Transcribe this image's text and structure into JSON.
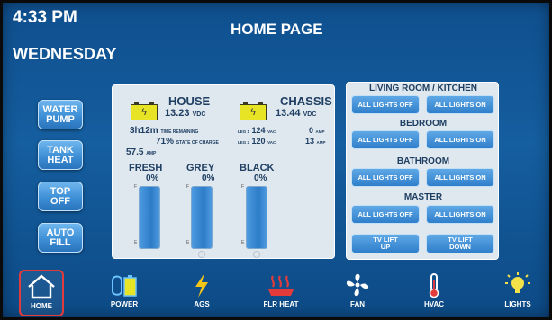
{
  "status": {
    "time": "4:33 PM",
    "day": "WEDNESDAY",
    "page_title": "HOME PAGE"
  },
  "side_buttons": [
    {
      "label": "WATER\nPUMP"
    },
    {
      "label": "TANK\nHEAT"
    },
    {
      "label": "TOP\nOFF"
    },
    {
      "label": "AUTO\nFILL"
    }
  ],
  "power": {
    "house": {
      "title": "HOUSE",
      "bolt": "ϟ",
      "voltage": "13.23",
      "voltage_unit": "VDC",
      "time_value": "3h12m",
      "time_label": "TIME REMAINING",
      "charge_value": "71%",
      "charge_label": "STATE OF CHARGE",
      "amps_value": "57.5",
      "amps_unit": "AMP"
    },
    "chassis": {
      "title": "CHASSIS",
      "bolt": "ϟ",
      "voltage": "13.44",
      "voltage_unit": "VDC",
      "leg1_label": "LEG 1",
      "leg1_value": "124",
      "leg1_unit": "VAC",
      "leg1_amps": "0",
      "leg1_amps_unit": "AMP",
      "leg2_label": "LEG 2",
      "leg2_value": "120",
      "leg2_unit": "VAC",
      "leg2_amps": "13",
      "leg2_amps_unit": "AMP"
    },
    "tanks": [
      {
        "name": "FRESH",
        "percent": "0%",
        "full": "F",
        "empty": "E"
      },
      {
        "name": "GREY",
        "percent": "0%",
        "full": "F",
        "empty": "E"
      },
      {
        "name": "BLACK",
        "percent": "0%",
        "full": "F",
        "empty": "E"
      }
    ]
  },
  "lights": {
    "sections": [
      {
        "title": "LIVING ROOM / KITCHEN",
        "off": "ALL LIGHTS OFF",
        "on": "ALL LIGHTS ON"
      },
      {
        "title": "BEDROOM",
        "off": "ALL LIGHTS OFF",
        "on": "ALL LIGHTS ON"
      },
      {
        "title": "BATHROOM",
        "off": "ALL LIGHTS OFF",
        "on": "ALL LIGHTS ON"
      },
      {
        "title": "MASTER",
        "off": "ALL LIGHTS OFF",
        "on": "ALL LIGHTS ON"
      }
    ],
    "tv": {
      "up": "TV LIFT\nUP",
      "down": "TV LIFT\nDOWN"
    }
  },
  "nav": [
    {
      "label": "HOME",
      "icon": "home-icon",
      "active": true
    },
    {
      "label": "POWER",
      "icon": "power-icon"
    },
    {
      "label": "AGS",
      "icon": "lightning-icon"
    },
    {
      "label": "FLR HEAT",
      "icon": "floor-heat-icon"
    },
    {
      "label": "FAN",
      "icon": "fan-icon"
    },
    {
      "label": "HVAC",
      "icon": "thermometer-icon"
    },
    {
      "label": "LIGHTS",
      "icon": "bulb-icon"
    }
  ],
  "colors": {
    "background": "#155e9f",
    "accent_button": "#3d8fd6",
    "battery": "#e7e426",
    "active_nav": "#e23b3b"
  }
}
